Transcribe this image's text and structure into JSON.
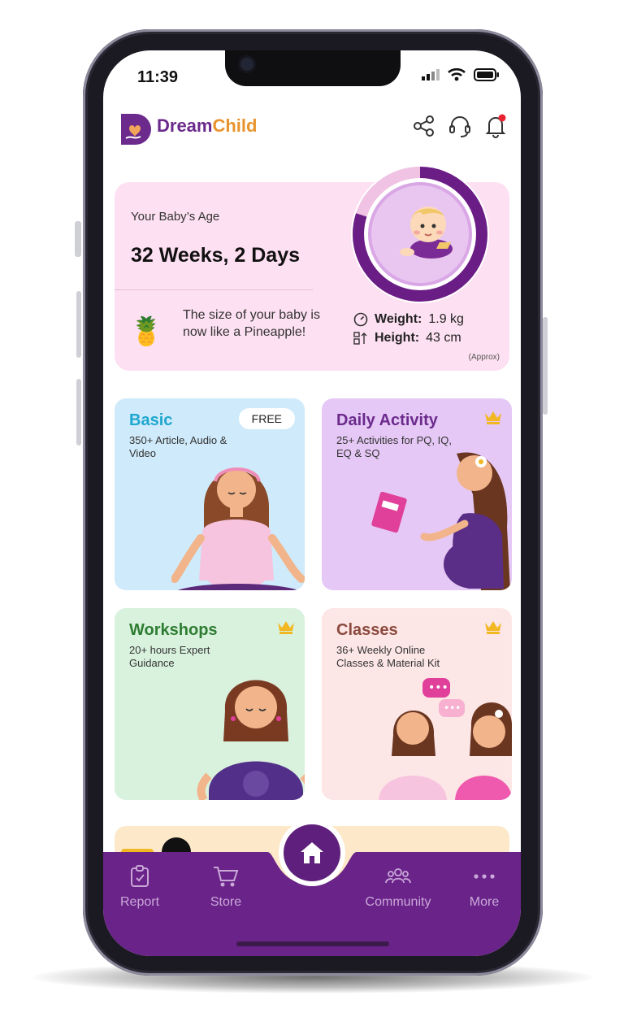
{
  "status": {
    "time": "11:39"
  },
  "brand": {
    "part1": "Dream",
    "part2": "Child"
  },
  "header_icons": [
    "share-icon",
    "headset-icon",
    "bell-icon"
  ],
  "baby": {
    "age_label": "Your Baby’s Age",
    "age_value": "32 Weeks, 2 Days",
    "size_text": "The size of your baby is now like a Pineapple!",
    "weight_label": "Weight:",
    "weight_value": "1.9 kg",
    "height_label": "Height:",
    "height_value": "43 cm",
    "approx": "(Approx)",
    "progress_fraction": 0.8
  },
  "tiles": [
    {
      "title": "Basic",
      "subtitle": "350+ Article, Audio & Video",
      "badge": "FREE",
      "title_color": "#1ea7cf",
      "bg": "#cfeafa"
    },
    {
      "title": "Daily Activity",
      "subtitle": "25+ Activities for PQ, IQ, EQ & SQ",
      "premium": true,
      "title_color": "#6b2a8c",
      "bg": "#e5c8f5"
    },
    {
      "title": "Workshops",
      "subtitle": "20+ hours Expert Guidance",
      "premium": true,
      "title_color": "#2e7d32",
      "bg": "#d9f2de"
    },
    {
      "title": "Classes",
      "subtitle": "36+ Weekly Online Classes & Material Kit",
      "premium": true,
      "title_color": "#8b4a3e",
      "bg": "#fde6e6"
    }
  ],
  "nav": {
    "items": [
      {
        "label": "Report",
        "icon": "clipboard-icon"
      },
      {
        "label": "Store",
        "icon": "cart-icon"
      },
      {
        "label": "Community",
        "icon": "people-icon"
      },
      {
        "label": "More",
        "icon": "more-dots-icon"
      }
    ],
    "home_icon": "home-icon",
    "color": "#6a2389"
  }
}
